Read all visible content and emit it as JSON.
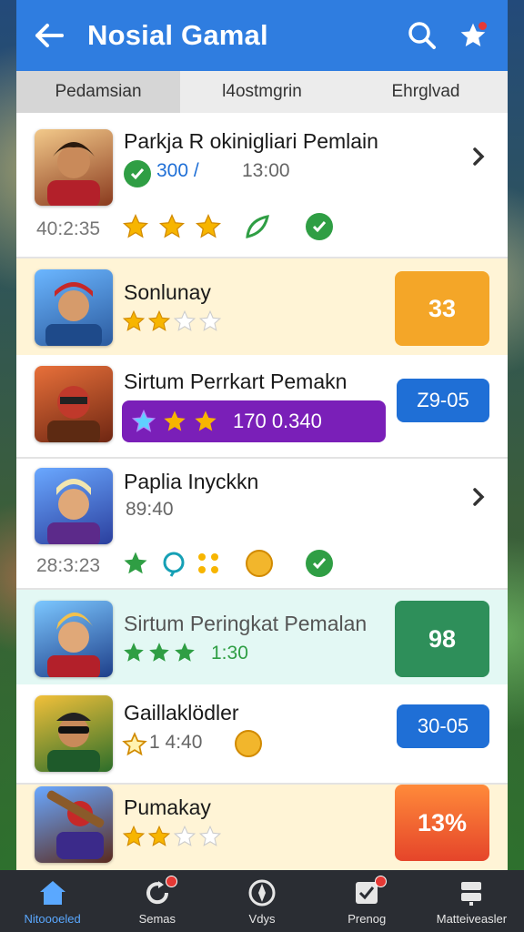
{
  "header": {
    "title": "Nosial Gamal",
    "back_icon": "arrow-left-icon",
    "search_icon": "search-icon",
    "favorites_icon": "star-icon"
  },
  "tabs": [
    {
      "label": "Pedamsian",
      "active": true
    },
    {
      "label": "l4ostmgrin",
      "active": false
    },
    {
      "label": "Ehrglvad",
      "active": false
    }
  ],
  "games": [
    {
      "name": "Parkja R okinigliari Pemlain",
      "score_text": "300 /",
      "time": "13:00",
      "timestamp": "40:2:35",
      "rating": 3,
      "accent": "#2f9e44"
    },
    {
      "name": "Sonlunay",
      "rating": 2,
      "score": "33",
      "score_color": "#f4a628"
    },
    {
      "name": "Sirtum Perrkart Pemakn",
      "banner_text": "170 0.340",
      "banner_color": "#7a1fb8",
      "score": "Z9-05",
      "score_color": "#1f6fd6"
    },
    {
      "name": "Paplia Inyckkn",
      "sub": "89:40",
      "timestamp": "28:3:23"
    },
    {
      "name": "Sirtum Peringkat Pemalan",
      "sub": "1:30",
      "score": "98",
      "score_color": "#2e8f5a"
    },
    {
      "name": "Gaillaklödler",
      "sub": "1 4:40",
      "score": "30-05",
      "score_color": "#1f6fd6"
    },
    {
      "name": "Pumakay",
      "rating": 2,
      "score": "13%",
      "score_color": "#ee5a24"
    }
  ],
  "bottom_nav": [
    {
      "label": "Nitoooeled",
      "icon": "home-icon",
      "active": true,
      "badge": false
    },
    {
      "label": "Semas",
      "icon": "refresh-icon",
      "active": false,
      "badge": true
    },
    {
      "label": "Vdys",
      "icon": "compass-icon",
      "active": false,
      "badge": false
    },
    {
      "label": "Prenog",
      "icon": "check-box-icon",
      "active": false,
      "badge": true
    },
    {
      "label": "Matteiveasler",
      "icon": "server-icon",
      "active": false,
      "badge": false
    }
  ],
  "colors": {
    "primary": "#2f7de0",
    "nav_bg": "#2a2d33",
    "star": "#f7b500",
    "row_highlight_yellow": "#fff4d6",
    "row_highlight_teal": "#e3f8f4"
  }
}
